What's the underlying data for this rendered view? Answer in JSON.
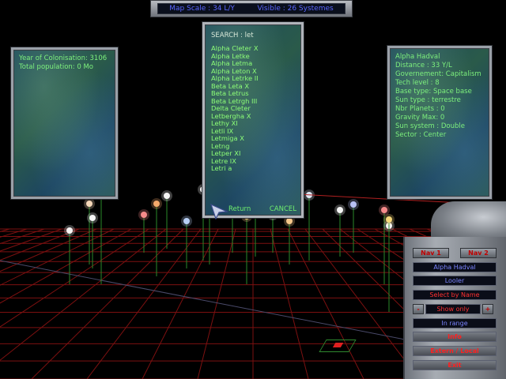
{
  "top_bar": {
    "map_scale": "Map Scale : 34 L/Y",
    "visible": "Visible : 26 Systemes"
  },
  "left_panel": {
    "lines": [
      "Year of Colonisation: 3106",
      "Total population: 0 Mo"
    ]
  },
  "search_panel": {
    "search_text": "SEARCH : let",
    "results": [
      "Alpha Cleter X",
      "Alpha Letke",
      "Alpha Letma",
      "Alpha Leton X",
      "Alpha Letrke II",
      "Beta Leta  X",
      "Beta Letrus",
      "Beta Letrgh III",
      "Delta Cleter",
      "Letbergha X",
      "Lethy XI",
      "Letli IX",
      "Letmiga X",
      "Letng",
      "Letper XI",
      "Letre IX",
      "Letri  a"
    ],
    "return_label": "Return",
    "cancel_label": "CANCEL"
  },
  "right_panel": {
    "lines": [
      "Alpha Hadval",
      "Distance  : 33 Y/L",
      "Governement: Capitalism",
      "Tech level : 8",
      "Base type: Space base",
      "Sun type  : terrestre",
      "Nbr Planets : 0",
      "Gravity Max: 0",
      "Sun system : Double",
      "Sector    : Center"
    ]
  },
  "controls": {
    "nav1": "Nav 1",
    "nav2": "Nav 2",
    "system_name": "Alpha Hadval",
    "looler": "Looler",
    "select_by_name": "Select by Name",
    "minus": "-",
    "show_only": "Show only",
    "plus": "+",
    "in_range": "In range",
    "info": "Info",
    "extern_local": "Extern / Local",
    "exit": "Exit"
  },
  "colors": {
    "grid": "#8a1010",
    "panel_text": "#7df07d",
    "top_text": "#5a66ff",
    "button_text": "#ff3030"
  }
}
